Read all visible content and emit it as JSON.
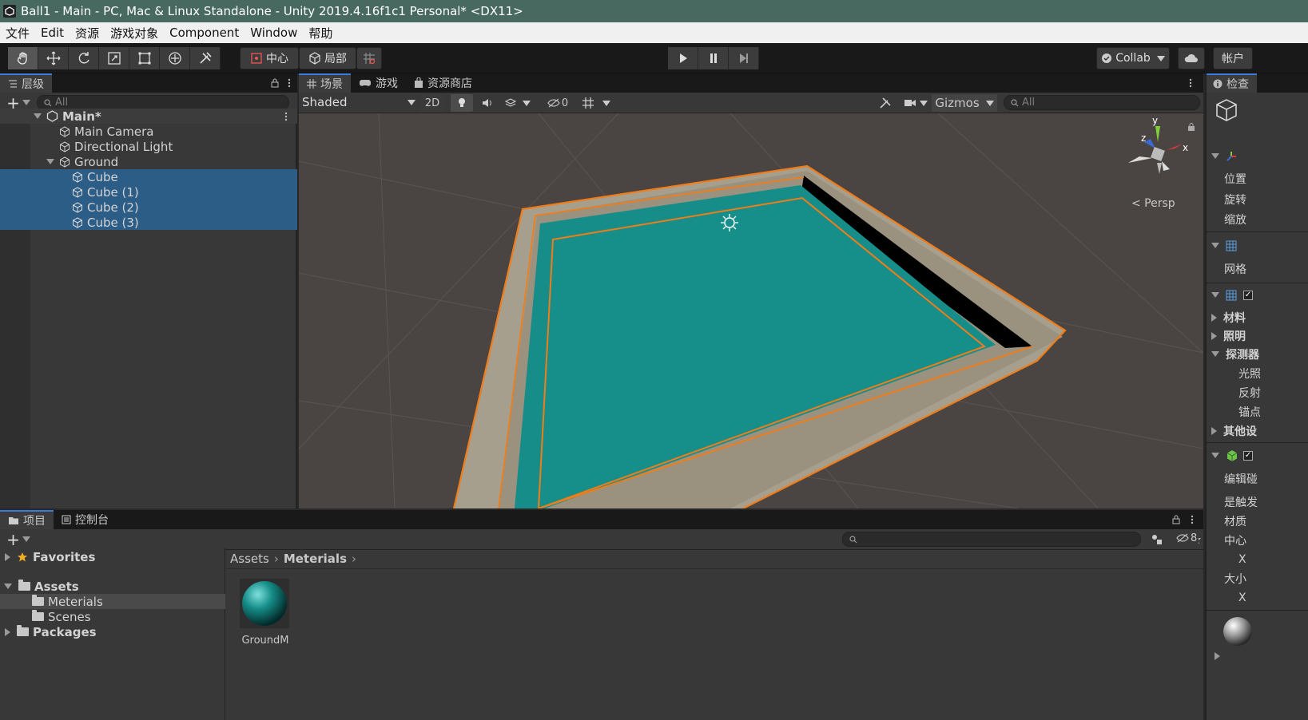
{
  "window": {
    "title": "Ball1 - Main - PC, Mac & Linux Standalone - Unity 2019.4.16f1c1 Personal* <DX11>"
  },
  "menu": {
    "items": [
      "文件",
      "Edit",
      "资源",
      "游戏对象",
      "Component",
      "Window",
      "帮助"
    ]
  },
  "toolbar": {
    "pivot_label": "中心",
    "space_label": "局部",
    "collab_label": "Collab",
    "account_label": "帐户"
  },
  "hierarchy": {
    "tab_label": "层级",
    "search_placeholder": "All",
    "scene_name": "Main*",
    "items": [
      {
        "label": "Main Camera"
      },
      {
        "label": "Directional Light"
      },
      {
        "label": "Ground"
      },
      {
        "label": "Cube"
      },
      {
        "label": "Cube (1)"
      },
      {
        "label": "Cube (2)"
      },
      {
        "label": "Cube (3)"
      }
    ]
  },
  "scene": {
    "tabs": [
      "场景",
      "游戏",
      "资源商店"
    ],
    "shading_mode": "Shaded",
    "mode_2d": "2D",
    "hidden_count": "0",
    "gizmos_label": "Gizmos",
    "search_placeholder": "All",
    "projection_label": "< Persp",
    "axis_y": "y",
    "axis_x": "x",
    "axis_z": "z",
    "colors": {
      "floor": "#168e8a",
      "wall": "#a79f8d",
      "selection": "#f07d1a",
      "ground": "#4a4542"
    }
  },
  "inspector": {
    "tab_label": "检查",
    "rows": [
      "位置",
      "旋转",
      "缩放",
      "网格",
      "材料",
      "照明",
      "探测器",
      "光照",
      "反射",
      "锚点",
      "其他设",
      "编辑碰",
      "是触发",
      "材质",
      "中心",
      "X",
      "大小",
      "X"
    ]
  },
  "project": {
    "tabs": [
      "项目",
      "控制台"
    ],
    "hidden_count": "8",
    "tree": {
      "favorites": "Favorites",
      "assets": "Assets",
      "meterials": "Meterials",
      "scenes": "Scenes",
      "packages": "Packages"
    },
    "breadcrumb": [
      "Assets",
      "Meterials"
    ],
    "asset_label": "GroundM"
  }
}
